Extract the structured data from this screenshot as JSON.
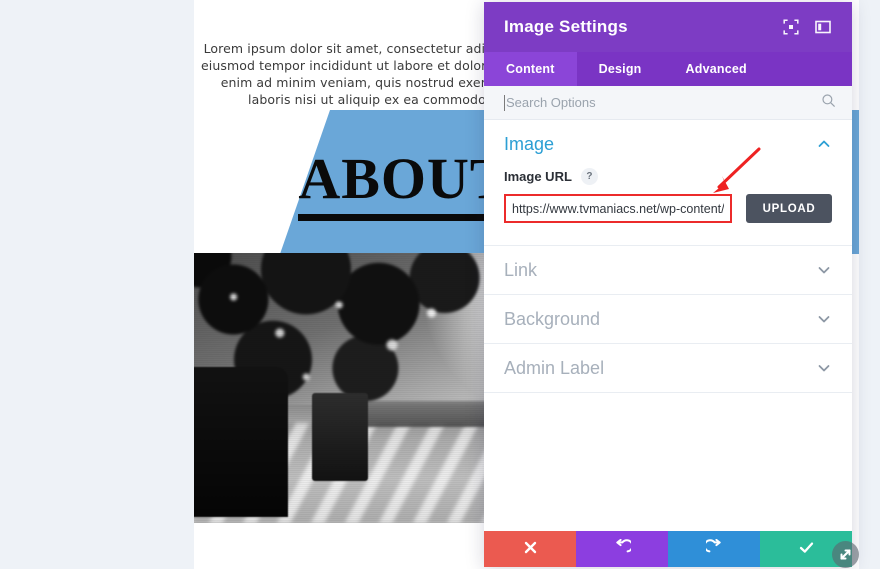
{
  "panel": {
    "title": "Image Settings",
    "header_icons": [
      {
        "name": "focus-target-icon",
        "glyph": "⊙"
      },
      {
        "name": "panel-layout-icon",
        "glyph": "▣"
      }
    ],
    "tabs": [
      {
        "label": "Content",
        "active": true
      },
      {
        "label": "Design",
        "active": false
      },
      {
        "label": "Advanced",
        "active": false
      }
    ],
    "search": {
      "placeholder": "Search Options",
      "value": "",
      "icon": "search-icon"
    },
    "sections": [
      {
        "title": "Image",
        "open": true,
        "chevron": "chevron-up-icon",
        "field": {
          "label": "Image URL",
          "help": "?",
          "value": "https://www.tvmaniacs.net/wp-content/u",
          "placeholder": "https://",
          "upload_label": "UPLOAD"
        }
      },
      {
        "title": "Link",
        "open": false,
        "chevron": "chevron-down-icon"
      },
      {
        "title": "Background",
        "open": false,
        "chevron": "chevron-down-icon"
      },
      {
        "title": "Admin Label",
        "open": false,
        "chevron": "chevron-down-icon"
      }
    ],
    "actions": [
      {
        "name": "cancel-button",
        "icon": "close-icon",
        "glyph": "✖",
        "color": "#eb5a50"
      },
      {
        "name": "undo-button",
        "icon": "undo-icon",
        "glyph": "↺",
        "color": "#8c3ee0"
      },
      {
        "name": "redo-button",
        "icon": "redo-icon",
        "glyph": "↻",
        "color": "#2f8fd8"
      },
      {
        "name": "save-button",
        "icon": "check-icon",
        "glyph": "✔",
        "color": "#2bbd9a"
      }
    ],
    "resize_handle_icon": "resize-diagonal-icon"
  },
  "page": {
    "paragraph": "Lorem ipsum dolor sit amet, consectetur adipiscing elit, sed do eiusmod tempor incididunt ut labore et dolore magna aliqua. Ut enim ad minim veniam, quis nostrud exercitation ullamco laboris nisi ut aliquip ex ea commodo consequat.",
    "heading": "ABOUT",
    "image_alt": "man-sitting-outdoors-grayscale-photo"
  },
  "annotation": {
    "arrow_color": "#ee2222",
    "highlight_color": "#ec2b2b"
  },
  "colors": {
    "panel_header": "#7d3cc4",
    "tab_bar": "#7a34c4",
    "tab_active": "#8b45d8",
    "section_open_title": "#2c9fd4",
    "upload_button": "#4c5360",
    "accent_blue_shape": "#6aa7d8",
    "workspace_bg": "#eef2f7"
  }
}
